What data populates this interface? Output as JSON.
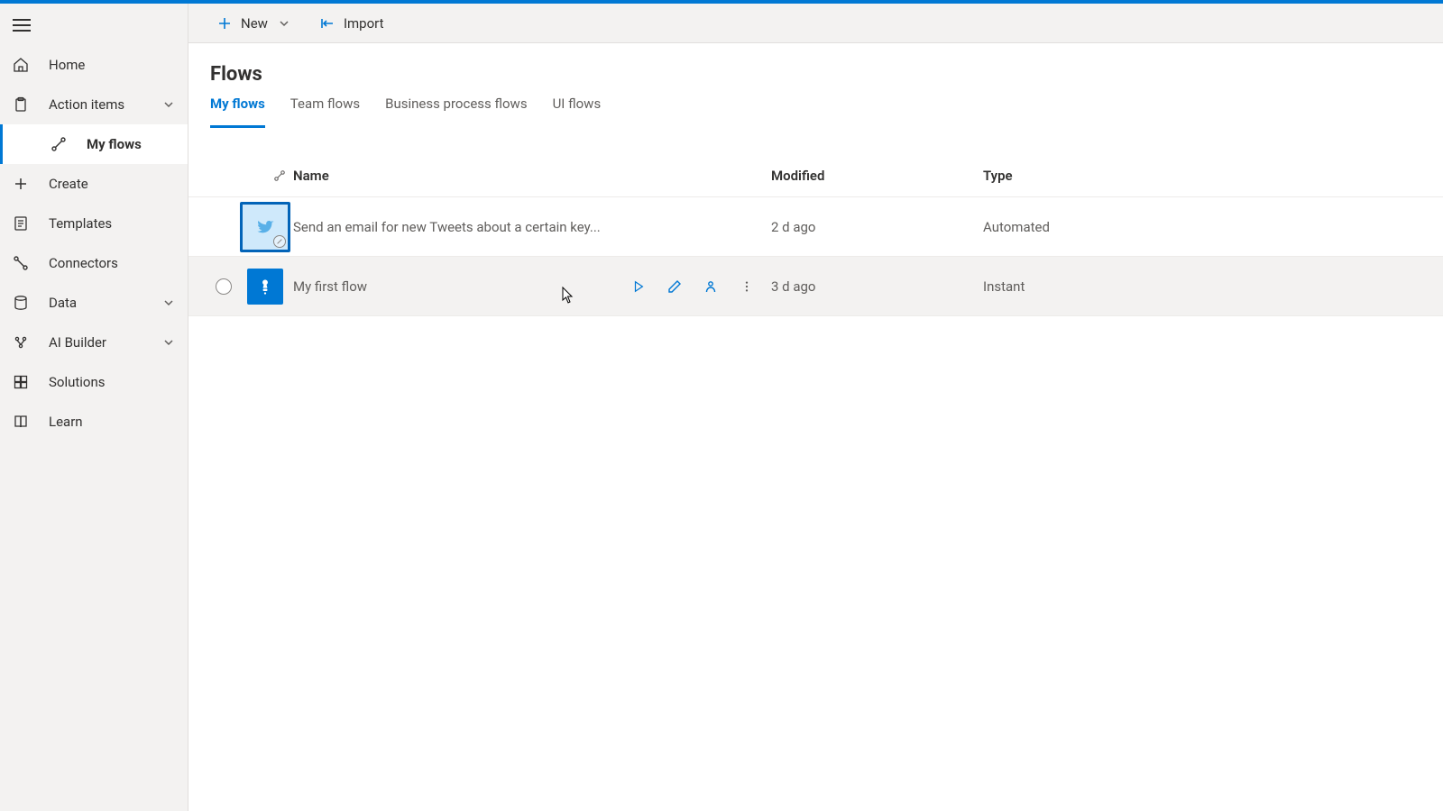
{
  "sidebar": {
    "items": [
      {
        "label": "Home"
      },
      {
        "label": "Action items"
      },
      {
        "label": "My flows"
      },
      {
        "label": "Create"
      },
      {
        "label": "Templates"
      },
      {
        "label": "Connectors"
      },
      {
        "label": "Data"
      },
      {
        "label": "AI Builder"
      },
      {
        "label": "Solutions"
      },
      {
        "label": "Learn"
      }
    ]
  },
  "cmdbar": {
    "new_label": "New",
    "import_label": "Import"
  },
  "page": {
    "title": "Flows"
  },
  "tabs": {
    "my": "My flows",
    "team": "Team flows",
    "bpf": "Business process flows",
    "ui": "UI flows"
  },
  "columns": {
    "name": "Name",
    "modified": "Modified",
    "type": "Type"
  },
  "rows": [
    {
      "name": "Send an email for new Tweets about a certain key...",
      "modified": "2 d ago",
      "type": "Automated"
    },
    {
      "name": "My first flow",
      "modified": "3 d ago",
      "type": "Instant"
    }
  ],
  "colors": {
    "accent": "#0078d4"
  }
}
